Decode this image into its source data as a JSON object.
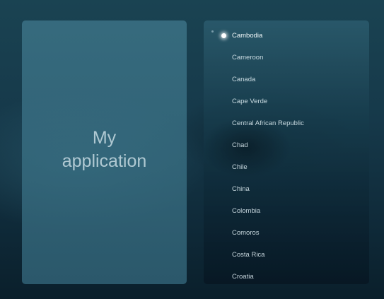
{
  "app": {
    "title_line1": "My",
    "title_line2": "application"
  },
  "country_list": {
    "current_index": 0,
    "items": [
      "Cambodia",
      "Cameroon",
      "Canada",
      "Cape Verde",
      "Central African Republic",
      "Chad",
      "Chile",
      "China",
      "Colombia",
      "Comoros",
      "Costa Rica",
      "Croatia"
    ]
  }
}
